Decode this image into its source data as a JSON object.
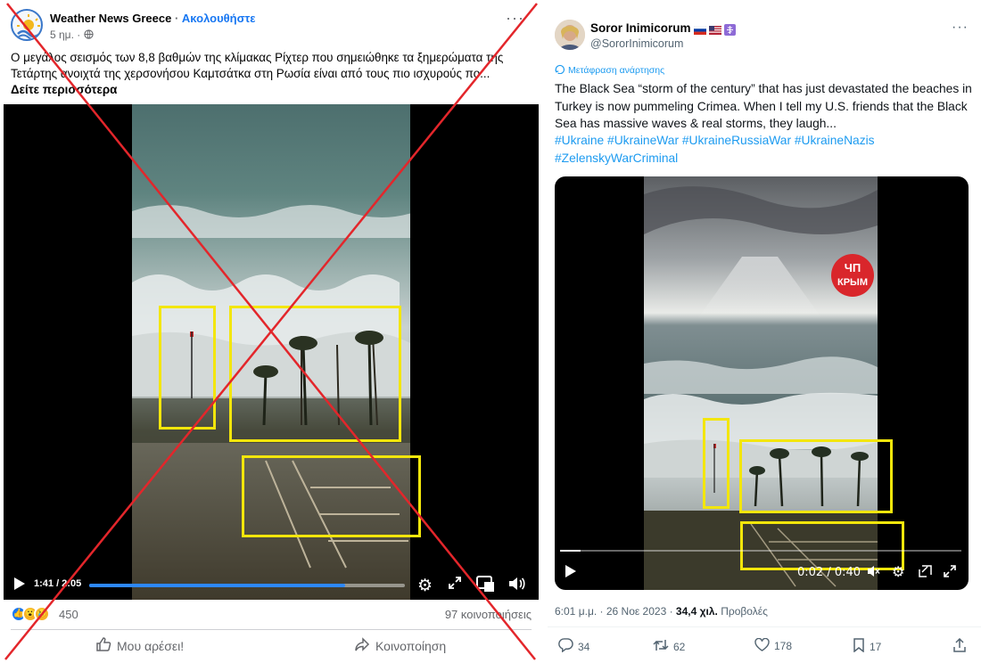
{
  "facebook": {
    "page_name": "Weather News Greece",
    "follow": "Ακολουθήστε",
    "time": "5 ημ.",
    "post_text": "Ο μεγάλος σεισμός των 8,8 βαθμών της κλίμακας Ρίχτερ που σημειώθηκε τα ξημερώματα της Τετάρτης ανοιχτά της χερσονήσου Καμτσάτκα στη Ρωσία είναι από τους πιο ισχυρούς πο...",
    "see_more": "Δείτε περισσότερα",
    "video_time": "1:41 / 2:05",
    "video_progress": 0.81,
    "reactions_count": "450",
    "shares": "97 κοινοποιήσεις",
    "like_label": "Μου αρέσει!",
    "share_label": "Κοινοποίηση",
    "icons": [
      "globe-icon",
      "more-icon",
      "play-icon",
      "settings-icon",
      "fullscreen-icon",
      "pip-icon",
      "volume-icon",
      "like-icon",
      "share-icon"
    ],
    "colors": {
      "link": "#1877f2",
      "progress": "#2d88ff",
      "cross": "#e3262b"
    }
  },
  "twitter": {
    "display_name": "Soror Inimicorum",
    "handle": "@SororInimicorum",
    "translate": "Μετάφραση ανάρτησης",
    "post_text": "The Black Sea “storm of the century” that has just devastated the beaches in Turkey is now pummeling Crimea. When I tell my U.S. friends that the Black Sea has massive waves & real storms, they laugh...",
    "hashtags": "#Ukraine #UkraineWar #UkraineRussiaWar #UkraineNazis #ZelenskyWarCriminal",
    "video_time": "0:02 / 0:40",
    "video_progress": 0.05,
    "watermark_line1": "ЧП",
    "watermark_line2": "КРЫМ",
    "date_text": "6:01 μ.μ. · 26 Νοε 2023 · ",
    "views": "34,4 χιλ.",
    "views_label": " Προβολές",
    "replies": "34",
    "reposts": "62",
    "likes": "178",
    "bookmarks": "17",
    "icons": [
      "translate-icon",
      "more-icon",
      "play-icon",
      "mute-icon",
      "settings-icon",
      "pip-icon",
      "fullscreen-icon",
      "reply-icon",
      "repost-icon",
      "heart-icon",
      "bookmark-icon",
      "share-icon"
    ],
    "colors": {
      "link": "#1d9bf0",
      "highlight": "#f3e60b"
    }
  }
}
